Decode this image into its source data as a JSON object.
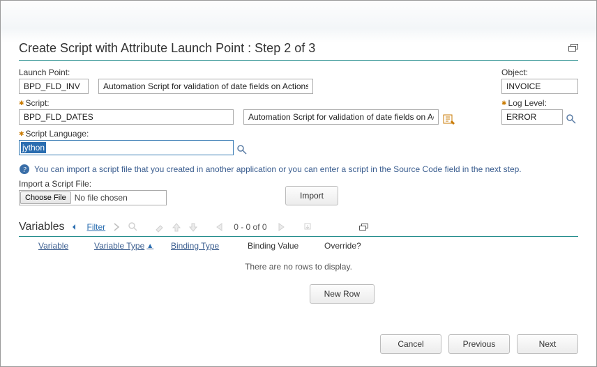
{
  "dialog": {
    "title": "Create Script with Attribute Launch Point : Step 2 of 3"
  },
  "launchPoint": {
    "label": "Launch Point:",
    "value": "BPD_FLD_INV",
    "desc": "Automation Script for validation of date fields on Actions. Invo"
  },
  "object": {
    "label": "Object:",
    "value": "INVOICE"
  },
  "script": {
    "label": "Script:",
    "value": "BPD_FLD_DATES",
    "desc": "Automation Script for validation of date fields on Actions"
  },
  "loglevel": {
    "label": "Log Level:",
    "value": "ERROR"
  },
  "scriptlang": {
    "label": "Script Language:",
    "value": "jython"
  },
  "info": "You can import a script file that you created in another application or you can enter a script in the Source Code field in the next step.",
  "importFile": {
    "label": "Import a Script File:",
    "button": "Choose File",
    "status": "No file chosen",
    "importBtn": "Import"
  },
  "variables": {
    "title": "Variables",
    "filter": "Filter",
    "pager": "0 - 0 of 0",
    "columns": {
      "variable": "Variable",
      "vartype": "Variable Type",
      "bindtype": "Binding Type",
      "bindval": "Binding Value",
      "override": "Override?"
    },
    "empty": "There are no rows to display.",
    "newrow": "New Row"
  },
  "footer": {
    "cancel": "Cancel",
    "previous": "Previous",
    "next": "Next"
  }
}
